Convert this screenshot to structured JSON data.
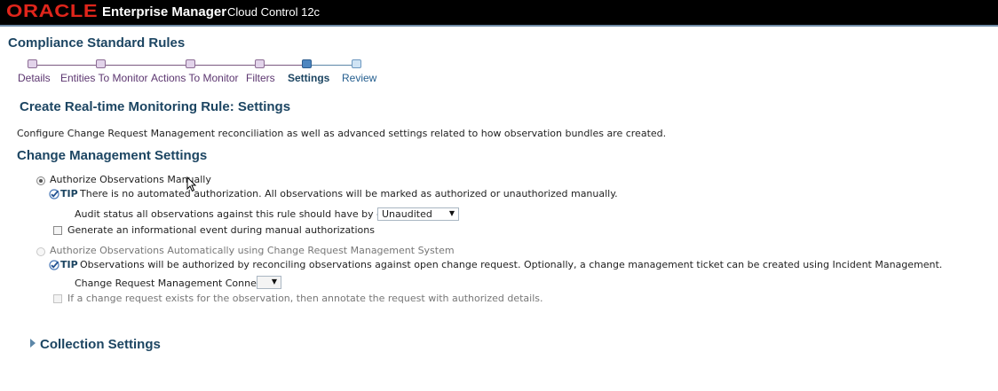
{
  "header": {
    "logo": "ORACLE",
    "product": "Enterprise Manager",
    "edition": "Cloud Control 12c"
  },
  "page": {
    "title": "Compliance Standard Rules"
  },
  "train": {
    "steps": [
      {
        "label": "Details",
        "state": "visited"
      },
      {
        "label": "Entities To Monitor",
        "state": "visited"
      },
      {
        "label": "Actions To Monitor",
        "state": "visited"
      },
      {
        "label": "Filters",
        "state": "visited"
      },
      {
        "label": "Settings",
        "state": "current"
      },
      {
        "label": "Review",
        "state": "future"
      }
    ]
  },
  "settings": {
    "heading": "Create Real-time Monitoring Rule: Settings",
    "description": "Configure Change Request Management reconciliation as well as advanced settings related to how observation bundles are created.",
    "change_mgmt": {
      "heading": "Change Management Settings",
      "manual": {
        "label": "Authorize Observations Manually",
        "selected": true,
        "tip_word": "TIP",
        "tip": "There is no automated authorization. All observations will be marked as authorized or unauthorized manually.",
        "audit_label": "Audit status all observations against this rule should have by default",
        "audit_value": "Unaudited",
        "event_label": "Generate an informational event during manual authorizations",
        "event_checked": false
      },
      "automatic": {
        "label": "Authorize Observations Automatically using Change Request Management System",
        "selected": false,
        "disabled": true,
        "tip_word": "TIP",
        "tip": "Observations will be authorized by reconciling observations against open change request. Optionally, a change management ticket can be created using Incident Management.",
        "connector_label": "Change Request Management Connector",
        "connector_value": "",
        "annotate_label": "If a change request exists for the observation, then annotate the request with authorized details.",
        "annotate_checked": false
      }
    },
    "collection": {
      "heading": "Collection Settings",
      "expanded": false
    }
  },
  "colors": {
    "brand_red": "#e0251b",
    "heading_blue": "#1c4562"
  },
  "icons": {
    "tip": "check-circle-icon",
    "dropdown": "chevron-down-icon",
    "disclosure": "disclosure-right-icon",
    "cursor": "mouse-pointer-icon"
  }
}
